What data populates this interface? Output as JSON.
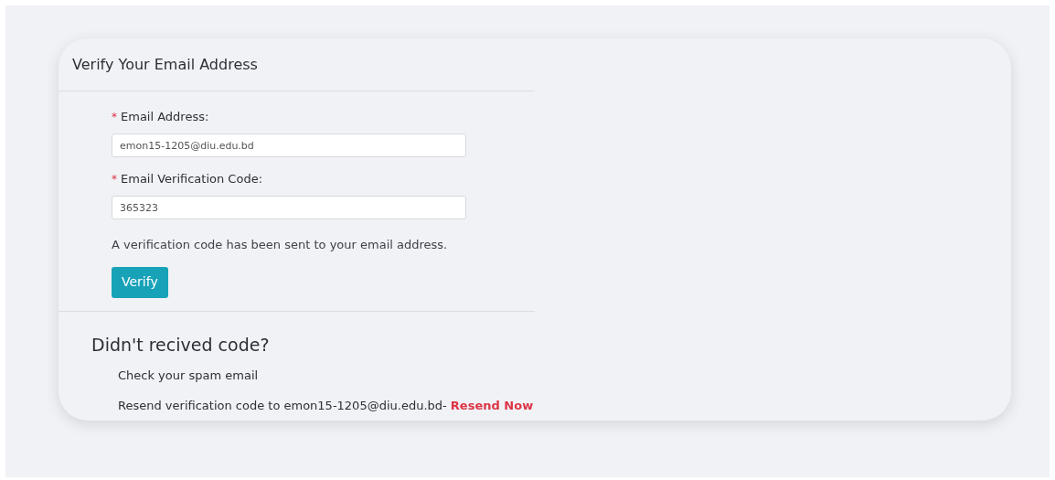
{
  "card": {
    "title": "Verify Your Email Address"
  },
  "fields": [
    {
      "label": "Email Address:",
      "required_mark": "*",
      "value": "emon15-1205@diu.edu.bd"
    },
    {
      "label": "Email Verification Code:",
      "required_mark": "*",
      "value": "365323"
    }
  ],
  "info": "A verification code has been sent to your email address.",
  "button": "Verify",
  "help": {
    "heading": "Didn't recived code?",
    "tip": "Check your spam email",
    "resend_text": "Resend verification code to emon15-1205@diu.edu.bd-",
    "resend_link": "Resend Now"
  }
}
